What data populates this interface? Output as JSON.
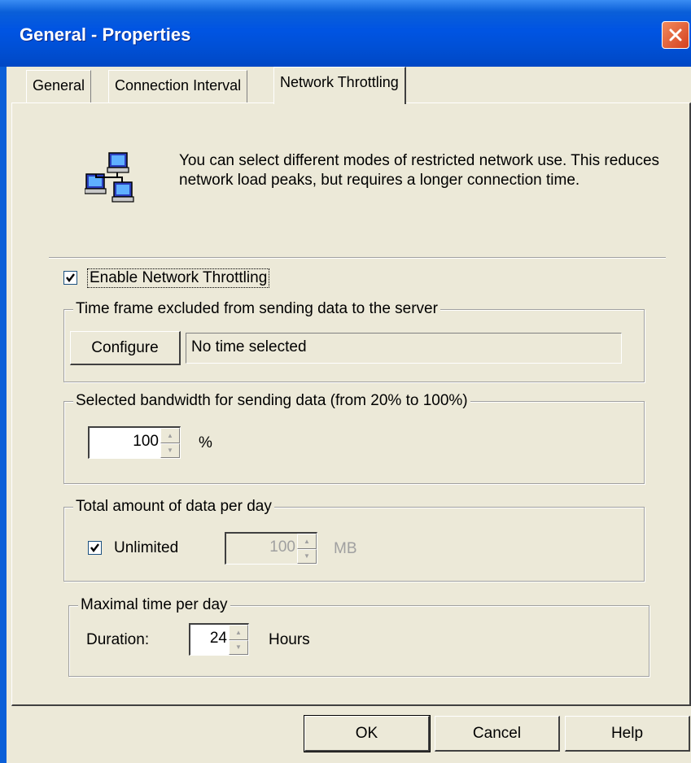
{
  "window": {
    "title": "General - Properties",
    "close_label": "✕"
  },
  "tabs": [
    {
      "label": "General",
      "active": false
    },
    {
      "label": "Connection Interval",
      "active": false
    },
    {
      "label": "Network Throttling",
      "active": true
    }
  ],
  "description": {
    "icon": "network-computers-icon",
    "text": "You can select different modes of restricted network use. This reduces network load peaks, but requires a longer connection time."
  },
  "enable_throttling": {
    "label": "Enable Network Throttling",
    "checked": true
  },
  "time_frame": {
    "legend": "Time frame excluded from sending data to the server",
    "configure_label": "Configure",
    "status_value": "No time selected"
  },
  "bandwidth": {
    "legend": "Selected bandwidth for sending data (from 20% to 100%)",
    "value": "100",
    "unit": "%"
  },
  "total_data": {
    "legend": "Total amount of data  per day",
    "unlimited_label": "Unlimited",
    "unlimited_checked": true,
    "value": "100",
    "unit": "MB"
  },
  "max_time": {
    "legend": "Maximal time per day",
    "duration_label": "Duration:",
    "value": "24",
    "unit": "Hours"
  },
  "buttons": {
    "ok": "OK",
    "cancel": "Cancel",
    "help": "Help"
  },
  "colors": {
    "titlebar": "#0054e3",
    "face": "#ece9d8",
    "close": "#d5401e"
  }
}
